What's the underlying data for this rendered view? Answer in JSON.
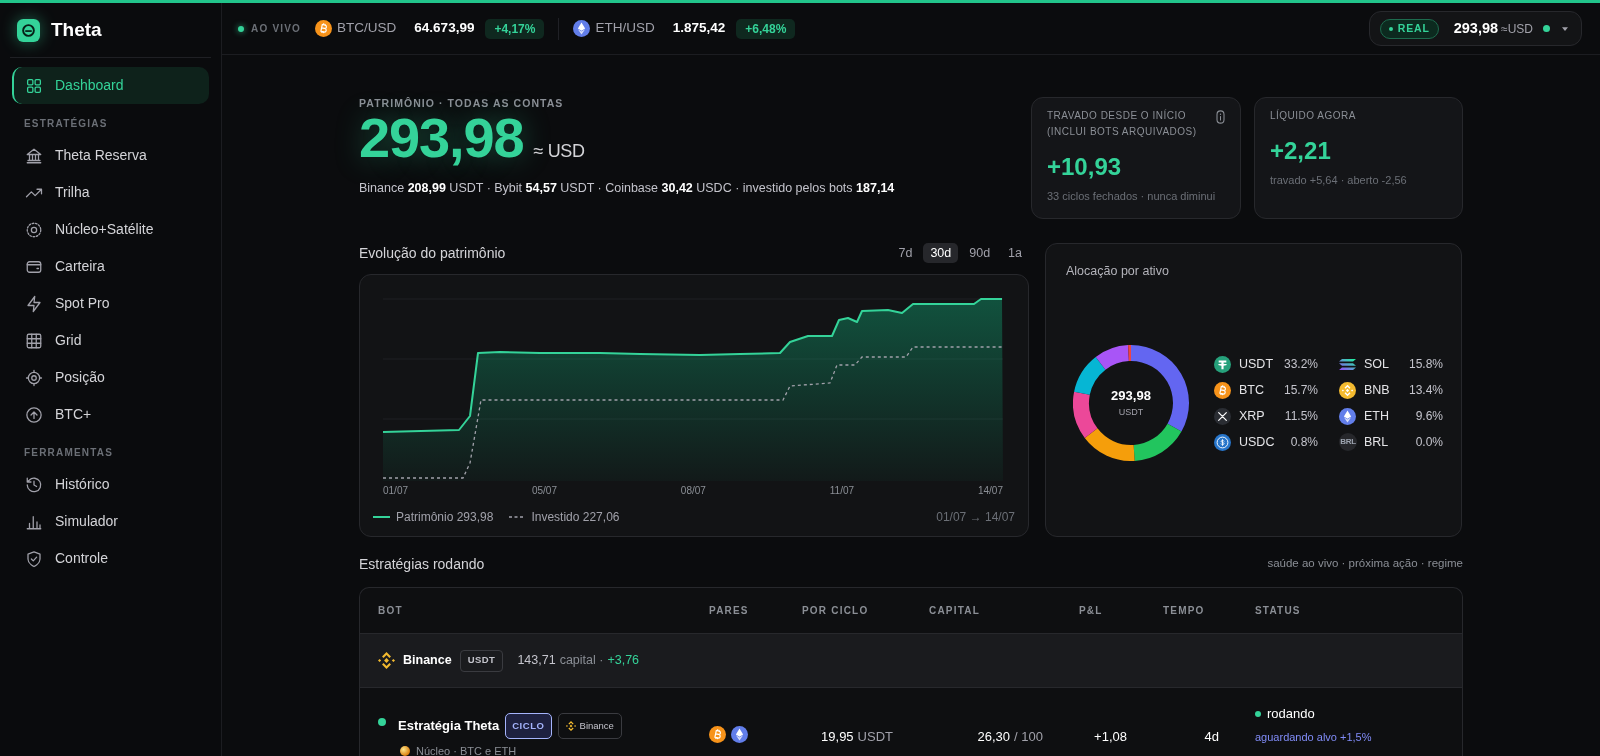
{
  "sidebar": {
    "logo": "Theta",
    "sections": [
      {
        "items": [
          {
            "label": "Dashboard",
            "selected": true
          }
        ]
      },
      {
        "title": "ESTRATÉGIAS",
        "items": [
          {
            "label": "Theta Reserva",
            "selected": false
          },
          {
            "label": "Trilha",
            "selected": false
          },
          {
            "label": "Núcleo+Satélite",
            "selected": false
          },
          {
            "label": "Carteira",
            "selected": false
          },
          {
            "label": "Spot Pro",
            "selected": false
          },
          {
            "label": "Grid",
            "selected": false
          },
          {
            "label": "Posição",
            "selected": false
          },
          {
            "label": "BTC+",
            "selected": false
          }
        ]
      },
      {
        "title": "FERRAMENTAS",
        "items": [
          {
            "label": "Histórico",
            "selected": false
          },
          {
            "label": "Simulador",
            "selected": false
          },
          {
            "label": "Controle",
            "selected": false
          }
        ]
      }
    ]
  },
  "ticker": {
    "live": "AO VIVO",
    "pairs": [
      {
        "pair": "BTC/USD",
        "price": "64.673,99",
        "change": "+4,17%"
      },
      {
        "pair": "ETH/USD",
        "price": "1.875,42",
        "change": "+6,48%"
      }
    ]
  },
  "account": {
    "mode": "REAL",
    "balance": "293,98",
    "unit": "≈USD",
    "online": true
  },
  "portfolio": {
    "label": "PATRIMÔNIO · TODAS AS CONTAS",
    "total": "293,98",
    "unit": "≈ USD",
    "breakdown": "Binance **208,99** USDT · Bybit **54,57** USDT · Coinbase **30,42** USDC · investido pelos bots **187,14**"
  },
  "stats": [
    {
      "label": "TRAVADO DESDE O INÍCIO (INCLUI BOTS ARQUIVADOS)",
      "info": true,
      "value": "+10,93",
      "note": "33 ciclos fechados · nunca diminui"
    },
    {
      "label": "LÍQUIDO AGORA",
      "info": false,
      "value": "+2,21",
      "note": "travado +5,64 · aberto -2,56"
    }
  ],
  "evolution": {
    "title": "Evolução do patrimônio",
    "ranges": [
      {
        "label": "7d",
        "selected": false
      },
      {
        "label": "30d",
        "selected": true
      },
      {
        "label": "90d",
        "selected": false
      },
      {
        "label": "1a",
        "selected": false
      }
    ],
    "x_labels": [
      "01/07",
      "05/07",
      "08/07",
      "11/07",
      "14/07"
    ],
    "legend": [
      {
        "kind": "solid",
        "label": "Patrimônio 293,98"
      },
      {
        "kind": "dashed",
        "label": "Investido 227,06"
      }
    ],
    "period": "01/07 → 14/07"
  },
  "allocation": {
    "title": "Alocação por ativo",
    "center_value": "293,98",
    "center_unit": "USDT",
    "chart_data": {
      "type": "donut",
      "values": [
        33.2,
        15.8,
        15.7,
        13.4,
        11.5,
        9.6,
        0.8,
        0.0
      ]
    },
    "legend": [
      {
        "asset": "USDT",
        "share": "33.2%",
        "color": "#6366f1"
      },
      {
        "asset": "SOL",
        "share": "15.8%",
        "color": "#22c55e"
      },
      {
        "asset": "BTC",
        "share": "15.7%",
        "color": "#f59e0b"
      },
      {
        "asset": "BNB",
        "share": "13.4%",
        "color": "#ec4899"
      },
      {
        "asset": "XRP",
        "share": "11.5%",
        "color": "#06b6d4"
      },
      {
        "asset": "ETH",
        "share": "9.6%",
        "color": "#a855f7"
      },
      {
        "asset": "USDC",
        "share": "0.8%",
        "color": "#ef4444"
      },
      {
        "asset": "BRL",
        "share": "0.0%",
        "icon_text": "BRL"
      }
    ]
  },
  "strategies": {
    "title": "Estratégias rodando",
    "hint": "saúde ao vivo · próxima ação · regime",
    "columns": [
      "BOT",
      "PARES",
      "POR CICLO",
      "CAPITAL",
      "P&L",
      "TEMPO",
      "STATUS"
    ],
    "groups": [
      {
        "exchange": "Binance",
        "currency": "USDT",
        "capital": "143,71",
        "capital_label": "capital ·",
        "pnl": "+3,76",
        "rows": [
          {
            "running": true,
            "name": "Estratégia Theta",
            "badges": [
              {
                "kind": "mode",
                "label": "CICLO"
              },
              {
                "kind": "exchange",
                "label": "Binance"
              }
            ],
            "detail": "Núcleo · BTC e ETH",
            "per_cycle": "19,95",
            "per_cycle_unit": "USDT",
            "capital": "26,30",
            "capital_max": "/ 100",
            "pnl": "+1,08",
            "time": "4d",
            "status": "rodando",
            "next_action": "aguardando alvo +1,5%"
          }
        ]
      }
    ]
  }
}
